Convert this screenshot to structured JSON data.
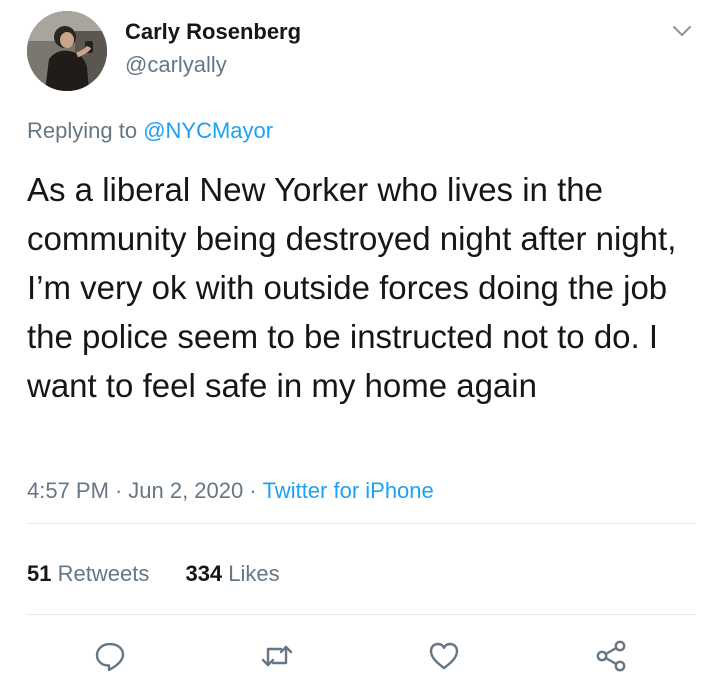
{
  "author": {
    "display_name": "Carly Rosenberg",
    "handle": "@carlyally",
    "avatar_icon": "profile-photo"
  },
  "reply": {
    "prefix": "Replying to",
    "mention": "@NYCMayor"
  },
  "tweet": {
    "text": "As a liberal New Yorker who lives in the community being destroyed night after night, I’m very ok with outside forces doing the job the police seem to be instructed not to do. I want to feel safe in my home again"
  },
  "meta": {
    "time": "4:57 PM",
    "separator": "·",
    "date": "Jun 2, 2020",
    "source": "Twitter for iPhone"
  },
  "stats": {
    "retweets_count": "51",
    "retweets_label": "Retweets",
    "likes_count": "334",
    "likes_label": "Likes"
  },
  "actions": [
    "reply-icon",
    "retweet-icon",
    "like-icon",
    "share-icon"
  ],
  "colors": {
    "text": "#14171a",
    "secondary": "#657786",
    "link": "#1da1f2",
    "divider": "#e1e8ed",
    "icon": "#657786"
  }
}
